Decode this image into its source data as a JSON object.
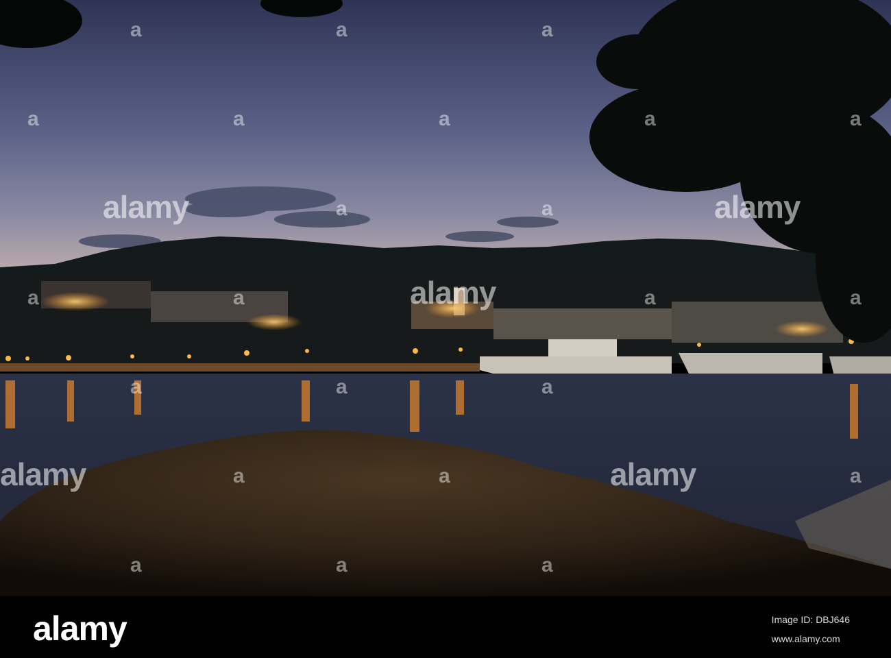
{
  "photo": {
    "description": "",
    "colors": {
      "sky_top": "#3a3f60",
      "sky_mid": "#5f6688",
      "sky_horizon": "#c8b8b8",
      "hills": "#141c1c",
      "water": "#2a3145",
      "lights": "#ffb040",
      "foreground": "#3a2a1c"
    }
  },
  "watermark": {
    "text": "alamy",
    "small_mark": "a"
  },
  "footer": {
    "logo": "alamy",
    "image_id": "Image ID: DBJ646",
    "site": "www.alamy.com"
  }
}
